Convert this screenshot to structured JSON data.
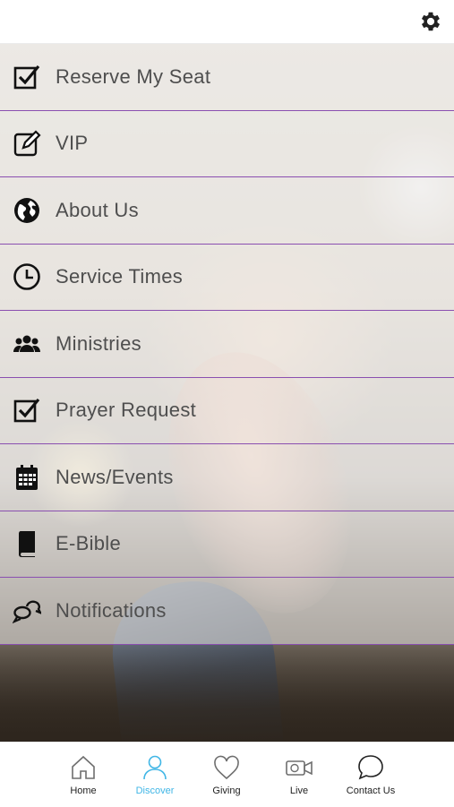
{
  "topbar": {
    "settings_icon": "gear-icon"
  },
  "menu": {
    "divider_color": "#8a4fb0",
    "items": [
      {
        "label": "Reserve My Seat",
        "icon": "checkbox-icon"
      },
      {
        "label": "VIP",
        "icon": "edit-icon"
      },
      {
        "label": "About Us",
        "icon": "globe-icon"
      },
      {
        "label": "Service Times",
        "icon": "clock-icon"
      },
      {
        "label": "Ministries",
        "icon": "group-icon"
      },
      {
        "label": "Prayer Request",
        "icon": "checkbox-icon"
      },
      {
        "label": "News/Events",
        "icon": "calendar-icon"
      },
      {
        "label": "E-Bible",
        "icon": "book-icon"
      },
      {
        "label": "Notifications",
        "icon": "chat-bubbles-icon"
      }
    ]
  },
  "tabbar": {
    "active_color": "#40b6e6",
    "tabs": [
      {
        "label": "Home",
        "icon": "home-icon",
        "active": false
      },
      {
        "label": "Discover",
        "icon": "user-icon",
        "active": true
      },
      {
        "label": "Giving",
        "icon": "heart-icon",
        "active": false
      },
      {
        "label": "Live",
        "icon": "video-camera-icon",
        "active": false
      },
      {
        "label": "Contact Us",
        "icon": "chat-icon",
        "active": false
      }
    ]
  }
}
